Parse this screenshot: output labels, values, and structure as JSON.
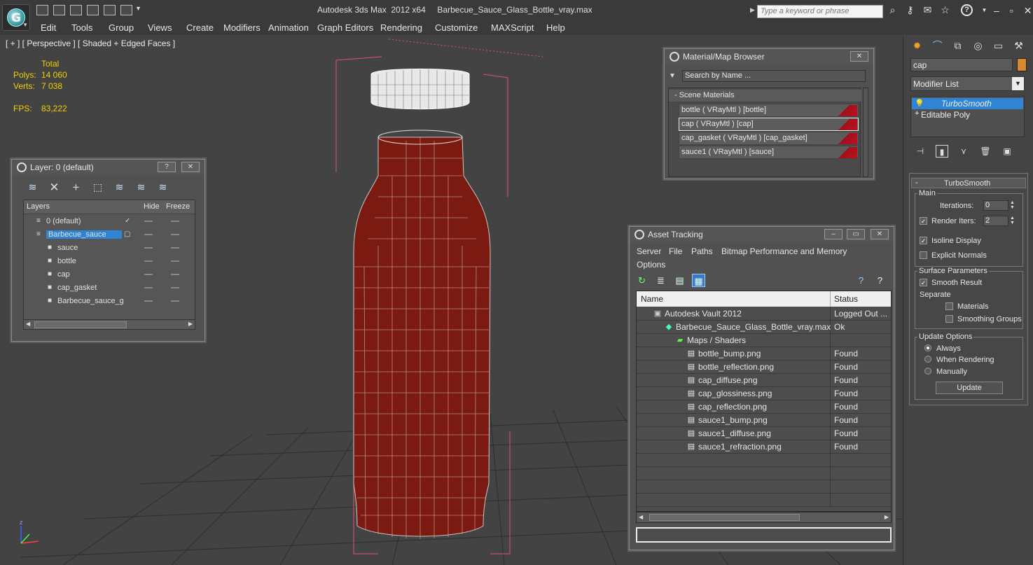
{
  "titlebar": {
    "title": "Autodesk 3ds Max  2012 x64     Barbecue_Sauce_Glass_Bottle_vray.max",
    "search_placeholder": "Type a keyword or phrase",
    "logo_letter": "G"
  },
  "menu": [
    "Edit",
    "Tools",
    "Group",
    "Views",
    "Create",
    "Modifiers",
    "Animation",
    "Graph Editors",
    "Rendering",
    "Customize",
    "MAXScript",
    "Help"
  ],
  "viewport": {
    "label": "[ + ] [ Perspective ] [ Shaded + Edged Faces ]",
    "stats": {
      "total_label": "Total",
      "polys_label": "Polys:",
      "polys_value": "14 060",
      "verts_label": "Verts:",
      "verts_value": "7 038",
      "fps_label": "FPS:",
      "fps_value": "83,222"
    },
    "axis_label": "z",
    "colors": {
      "background": "#434343",
      "grid": "#2a2a2a",
      "sauce": "#7a1a10",
      "bbox": "#e0507a"
    }
  },
  "layer_panel": {
    "title": "Layer: 0 (default)",
    "help_btn": "?",
    "close_btn": "✕",
    "columns": {
      "layers": "Layers",
      "hide": "Hide",
      "freeze": "Freeze"
    },
    "rows": [
      {
        "name": "0 (default)",
        "level": 0,
        "icon": "layer-icon",
        "current": true
      },
      {
        "name": "Barbecue_sauce",
        "level": 0,
        "icon": "layer-icon",
        "selected": true
      },
      {
        "name": "sauce",
        "level": 1,
        "icon": "object-icon"
      },
      {
        "name": "bottle",
        "level": 1,
        "icon": "object-icon"
      },
      {
        "name": "cap",
        "level": 1,
        "icon": "object-icon"
      },
      {
        "name": "cap_gasket",
        "level": 1,
        "icon": "object-icon"
      },
      {
        "name": "Barbecue_sauce_g",
        "level": 1,
        "icon": "object-icon"
      }
    ]
  },
  "material_browser": {
    "title": "Material/Map Browser",
    "search_placeholder": "Search by Name ...",
    "group": "- Scene Materials",
    "materials": [
      {
        "name": "bottle  ( VRayMtl ) [bottle]",
        "active": false
      },
      {
        "name": "cap  ( VRayMtl ) [cap]",
        "active": true
      },
      {
        "name": "cap_gasket  ( VRayMtl ) [cap_gasket]",
        "active": false
      },
      {
        "name": "sauce1  ( VRayMtl ) [sauce]",
        "active": false
      }
    ]
  },
  "asset_tracking": {
    "title": "Asset Tracking",
    "menu": [
      "Server",
      "File",
      "Paths",
      "Bitmap Performance and Memory",
      "Options"
    ],
    "columns": {
      "name": "Name",
      "status": "Status"
    },
    "rows": [
      {
        "name": "Autodesk Vault 2012",
        "status": "Logged Out ...",
        "level": 0,
        "icon": "vault-icon"
      },
      {
        "name": "Barbecue_Sauce_Glass_Bottle_vray.max",
        "status": "Ok",
        "level": 1,
        "icon": "max-file-icon"
      },
      {
        "name": "Maps / Shaders",
        "status": "",
        "level": 2,
        "icon": "maps-icon"
      },
      {
        "name": "bottle_bump.png",
        "status": "Found",
        "level": 3,
        "icon": "image-file-icon"
      },
      {
        "name": "bottle_reflection.png",
        "status": "Found",
        "level": 3,
        "icon": "image-file-icon"
      },
      {
        "name": "cap_diffuse.png",
        "status": "Found",
        "level": 3,
        "icon": "image-file-icon"
      },
      {
        "name": "cap_glossiness.png",
        "status": "Found",
        "level": 3,
        "icon": "image-file-icon"
      },
      {
        "name": "cap_reflection.png",
        "status": "Found",
        "level": 3,
        "icon": "image-file-icon"
      },
      {
        "name": "sauce1_bump.png",
        "status": "Found",
        "level": 3,
        "icon": "image-file-icon"
      },
      {
        "name": "sauce1_diffuse.png",
        "status": "Found",
        "level": 3,
        "icon": "image-file-icon"
      },
      {
        "name": "sauce1_refraction.png",
        "status": "Found",
        "level": 3,
        "icon": "image-file-icon"
      }
    ]
  },
  "command_panel": {
    "object_name": "cap",
    "object_color": "#d88a2a",
    "modifier_list": "Modifier List",
    "stack": [
      {
        "name": "TurboSmooth",
        "selected": true,
        "icon": "lightbulb-icon"
      },
      {
        "name": "Editable Poly",
        "selected": false,
        "icon": "plus-icon"
      }
    ],
    "turbosmooth": {
      "header": "TurboSmooth",
      "collapse": "-",
      "main_label": "Main",
      "iterations_label": "Iterations:",
      "iterations_value": "0",
      "render_iters_label": "Render Iters:",
      "render_iters_value": "2",
      "render_iters_checked": true,
      "isoline_label": "Isoline Display",
      "isoline_checked": true,
      "explicit_normals_label": "Explicit Normals",
      "explicit_normals_checked": false,
      "surface_label": "Surface Parameters",
      "smooth_result_label": "Smooth Result",
      "smooth_result_checked": true,
      "separate_label": "Separate",
      "materials_label": "Materials",
      "smoothing_groups_label": "Smoothing Groups",
      "update_options_label": "Update Options",
      "always_label": "Always",
      "when_rendering_label": "When Rendering",
      "manually_label": "Manually",
      "update_mode": "Always",
      "update_button": "Update"
    }
  }
}
